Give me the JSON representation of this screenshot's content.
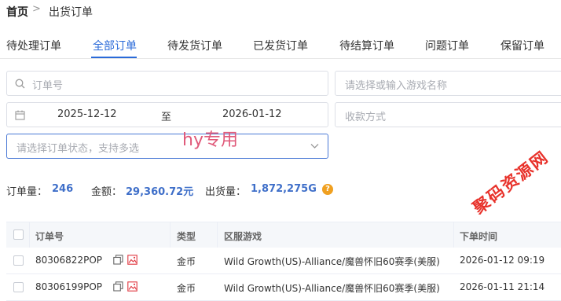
{
  "breadcrumb": {
    "home": "首页",
    "separator": ">",
    "current": "出货订单"
  },
  "tabs": [
    {
      "label": "待处理订单"
    },
    {
      "label": "全部订单",
      "active": true
    },
    {
      "label": "待发货订单"
    },
    {
      "label": "已发货订单"
    },
    {
      "label": "待结算订单"
    },
    {
      "label": "问题订单"
    },
    {
      "label": "保留订单"
    }
  ],
  "filters": {
    "order_no_placeholder": "订单号",
    "game_placeholder": "请选择或输入游戏名称",
    "date_start": "2025-12-12",
    "date_to": "至",
    "date_end": "2026-01-12",
    "payment_placeholder": "收款方式",
    "status_placeholder": "请选择订单状态，支持多选"
  },
  "overlay_text": "hy专用",
  "watermark": "聚码资源网",
  "stats": {
    "count_label": "订单量：",
    "count_value": "246",
    "amount_label": "金额：",
    "amount_value": "29,360.72元",
    "volume_label": "出货量：",
    "volume_value": "1,872,275G",
    "help": "?"
  },
  "table": {
    "headers": [
      "订单号",
      "类型",
      "区服游戏",
      "下单时间"
    ],
    "rows": [
      {
        "order_no": "80306822POP",
        "type": "金币",
        "server": "Wild Growth(US)-Alliance/魔兽怀旧60赛季(美服)",
        "time": "2026-01-12 09:19"
      },
      {
        "order_no": "80306199POP",
        "type": "金币",
        "server": "Wild Growth(US)-Alliance/魔兽怀旧60赛季(美服)",
        "time": "2026-01-11 21:14"
      }
    ]
  },
  "colors": {
    "accent": "#2a6ad9",
    "stat_value": "#3f6fc9",
    "help_badge": "#f0a020",
    "watermark": "#e8322b"
  }
}
